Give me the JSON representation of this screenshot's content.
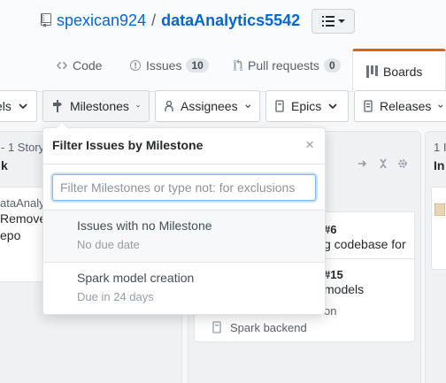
{
  "repo": {
    "owner": "spexican924",
    "separator": "/",
    "name": "dataAnalytics5542"
  },
  "tabs": {
    "code": "Code",
    "issues": "Issues",
    "issues_count": "10",
    "pull_requests": "Pull requests",
    "pull_requests_count": "0",
    "boards": "Boards"
  },
  "filters": {
    "labels": "els",
    "milestones": "Milestones",
    "assignees": "Assignees",
    "epics": "Epics",
    "releases": "Releases"
  },
  "board": {
    "col1": {
      "count": "- 1 Story",
      "title": "k",
      "card_repo": "ataAnaly",
      "card_line1": "Remove",
      "card_line2": "epo"
    },
    "col2": {
      "card1": {
        "number": "#6",
        "title": "g codebase for"
      },
      "card2": {
        "number": "#15",
        "title": "models",
        "meta": "on",
        "epic": "Spark backend"
      }
    },
    "col3": {
      "count": "1 I",
      "title": "In"
    }
  },
  "dropdown": {
    "title": "Filter Issues by Milestone",
    "close": "×",
    "filter_placeholder": "Filter Milestones or type not: for exclusions",
    "items": [
      {
        "title": "Issues with no Milestone",
        "sub": "No due date"
      },
      {
        "title": "Spark model creation",
        "sub": "Due in 24 days"
      }
    ]
  },
  "icons": {
    "repo": "repo-icon",
    "view": "list-icon",
    "code": "code-icon",
    "issues": "issue-icon",
    "pr": "pull-request-icon",
    "boards": "project-icon",
    "milestone": "milestone-icon",
    "assignee": "person-icon",
    "epic": "epic-icon",
    "release": "release-icon"
  },
  "colors": {
    "accent": "#0366d6",
    "active_tab": "#e36209"
  }
}
